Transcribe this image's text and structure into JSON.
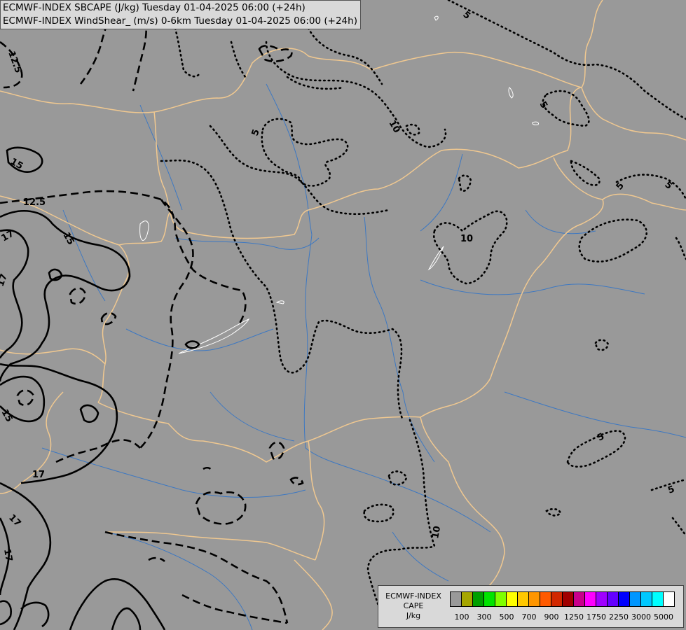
{
  "map": {
    "title_line1": "ECMWF-INDEX SBCAPE (J/kg) Tuesday 01-04-2025 06:00 (+24h)",
    "title_line2": "ECMWF-INDEX WindShear_ (m/s) 0-6km Tuesday 01-04-2025 06:00 (+24h)",
    "background_color": "#999999",
    "border_color": "#f0c890",
    "river_color": "#3d78c2",
    "lake_outline_color": "#ffffff",
    "contour_color": "#000000",
    "contour_labels": [
      "5",
      "5",
      "5",
      "5",
      "5",
      "5",
      "5",
      "10",
      "10",
      "10",
      "12.5",
      "12.5",
      "15",
      "15",
      "15",
      "17",
      "17",
      "17",
      "17",
      "17"
    ]
  },
  "legend": {
    "caption_line1": "ECMWF-INDEX",
    "caption_line2": "CAPE",
    "caption_line3": "J/kg",
    "colors": [
      "#999999",
      "#a6a600",
      "#00a000",
      "#00e400",
      "#7fff00",
      "#ffff00",
      "#ffc800",
      "#ff9600",
      "#ff5a00",
      "#d22800",
      "#a00000",
      "#c8008c",
      "#ff00ff",
      "#a000ff",
      "#6400ff",
      "#0000ff",
      "#0096ff",
      "#00c8ff",
      "#00ffff",
      "#ffffff"
    ],
    "tick_labels": [
      "100",
      "300",
      "500",
      "700",
      "900",
      "1250",
      "1750",
      "2250",
      "3000",
      "5000"
    ]
  }
}
